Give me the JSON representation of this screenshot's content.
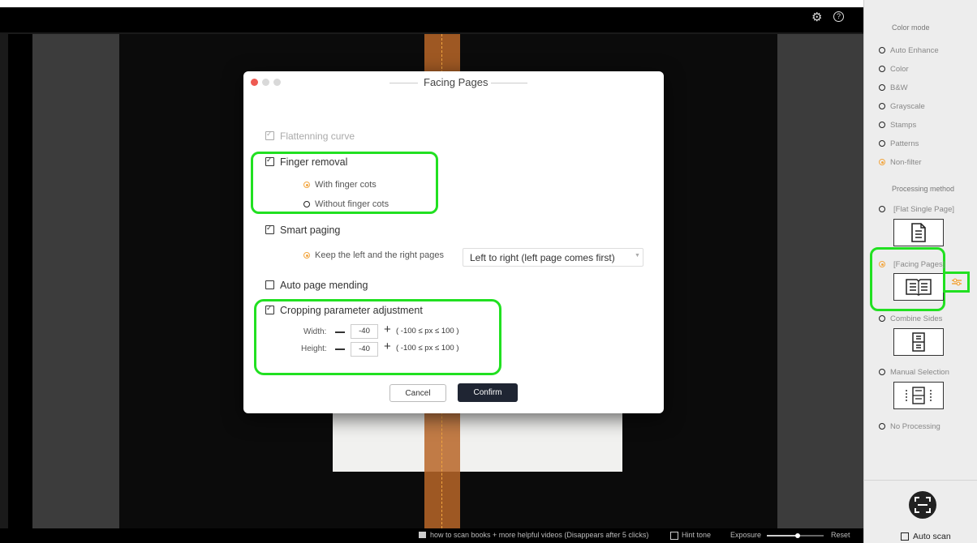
{
  "viewer": {
    "bottom": {
      "video_tip": "how to scan books + more helpful videos (Disappears after 5 clicks)",
      "hint_tone": "Hint tone",
      "exposure": "Exposure",
      "reset": "Reset"
    }
  },
  "dialog": {
    "title": "Facing Pages",
    "flattening": "Flattenning curve",
    "finger_removal": "Finger removal",
    "with_cots": "With finger cots",
    "without_cots": "Without finger cots",
    "smart_paging": "Smart paging",
    "keep_pages": "Keep the left and the right pages",
    "paging_select": "Left to right (left page comes first)",
    "auto_mending": "Auto page mending",
    "cropping": "Cropping parameter adjustment",
    "width_label": "Width:",
    "width_value": "-40",
    "width_range": "( -100 ≤ px ≤ 100 )",
    "height_label": "Height:",
    "height_value": "-40",
    "height_range": "( -100 ≤ px ≤ 100 )",
    "cancel": "Cancel",
    "confirm": "Confirm"
  },
  "sidebar": {
    "color_mode": "Color mode",
    "color_options": [
      "Auto Enhance",
      "Color",
      "B&W",
      "Grayscale",
      "Stamps",
      "Patterns",
      "Non-filter"
    ],
    "color_selected": "Non-filter",
    "processing_method": "Processing method",
    "methods": [
      "[Flat Single Page]",
      "[Facing Pages]",
      "Combine Sides",
      "Manual Selection",
      "No Processing"
    ],
    "method_selected": "[Facing Pages]",
    "auto_scan": "Auto scan"
  },
  "colors": {
    "accent": "#f2a640",
    "highlight": "#21e021",
    "confirm_bg": "#1f2533"
  }
}
